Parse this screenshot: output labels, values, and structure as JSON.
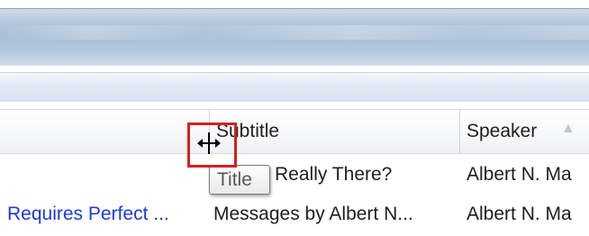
{
  "columns": [
    {
      "key": "title",
      "label": ""
    },
    {
      "key": "subtitle",
      "label": "Subtitle"
    },
    {
      "key": "speaker",
      "label": "Speaker",
      "sort_indicator": "▲"
    }
  ],
  "rows": [
    {
      "title": "",
      "subtitle": "Really There?",
      "speaker": "Albert N. Ma"
    },
    {
      "title": "Requires Perfect ...",
      "subtitle": "Messages by Albert N...",
      "speaker": "Albert N. Ma"
    }
  ],
  "tooltip": {
    "text": "Title"
  },
  "cursor": {
    "icon": "column-resize-icon"
  },
  "colors": {
    "highlight": "#d42020",
    "link": "#1c3bd8"
  }
}
